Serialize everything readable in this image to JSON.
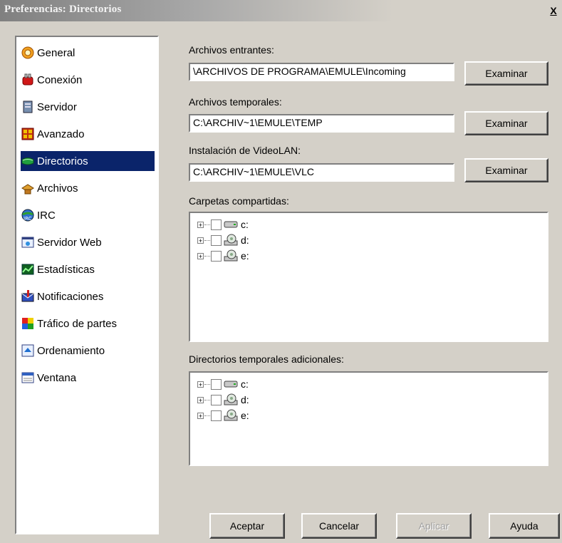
{
  "window": {
    "title": "Preferencias: Directorios",
    "close_label": "X"
  },
  "sidebar": {
    "items": [
      {
        "label": "General",
        "icon": "gear-icon",
        "active": false
      },
      {
        "label": "Conexión",
        "icon": "connection-icon",
        "active": false
      },
      {
        "label": "Servidor",
        "icon": "server-icon",
        "active": false
      },
      {
        "label": "Avanzado",
        "icon": "advanced-icon",
        "active": false
      },
      {
        "label": "Directorios",
        "icon": "folder-icon",
        "active": true
      },
      {
        "label": "Archivos",
        "icon": "files-icon",
        "active": false
      },
      {
        "label": "IRC",
        "icon": "irc-icon",
        "active": false
      },
      {
        "label": "Servidor Web",
        "icon": "web-server-icon",
        "active": false
      },
      {
        "label": "Estadísticas",
        "icon": "statistics-icon",
        "active": false
      },
      {
        "label": "Notificaciones",
        "icon": "notifications-icon",
        "active": false
      },
      {
        "label": "Tráfico de partes",
        "icon": "parts-traffic-icon",
        "active": false
      },
      {
        "label": "Ordenamiento",
        "icon": "sorting-icon",
        "active": false
      },
      {
        "label": "Ventana",
        "icon": "window-icon",
        "active": false
      }
    ]
  },
  "incoming": {
    "label": "Archivos entrantes:",
    "value": "\\ARCHIVOS DE PROGRAMA\\EMULE\\Incoming",
    "button": "Examinar"
  },
  "temp": {
    "label": "Archivos temporales:",
    "value": "C:\\ARCHIV~1\\EMULE\\TEMP",
    "button": "Examinar"
  },
  "videolan": {
    "label": "Instalación de VideoLAN:",
    "value": "C:\\ARCHIV~1\\EMULE\\VLC",
    "button": "Examinar"
  },
  "shared": {
    "label": "Carpetas compartidas:",
    "drives": [
      {
        "label": "c:",
        "icon": "hard-drive-icon"
      },
      {
        "label": "d:",
        "icon": "cd-drive-icon"
      },
      {
        "label": "e:",
        "icon": "cd-drive-icon"
      }
    ]
  },
  "extra_temp": {
    "label": "Directorios temporales adicionales:",
    "drives": [
      {
        "label": "c:",
        "icon": "hard-drive-icon"
      },
      {
        "label": "d:",
        "icon": "cd-drive-icon"
      },
      {
        "label": "e:",
        "icon": "cd-drive-icon"
      }
    ]
  },
  "footer": {
    "accept": "Aceptar",
    "cancel": "Cancelar",
    "apply": "Aplicar",
    "help": "Ayuda"
  },
  "colors": {
    "selection": "#0a246a",
    "face": "#d4d0c8"
  }
}
